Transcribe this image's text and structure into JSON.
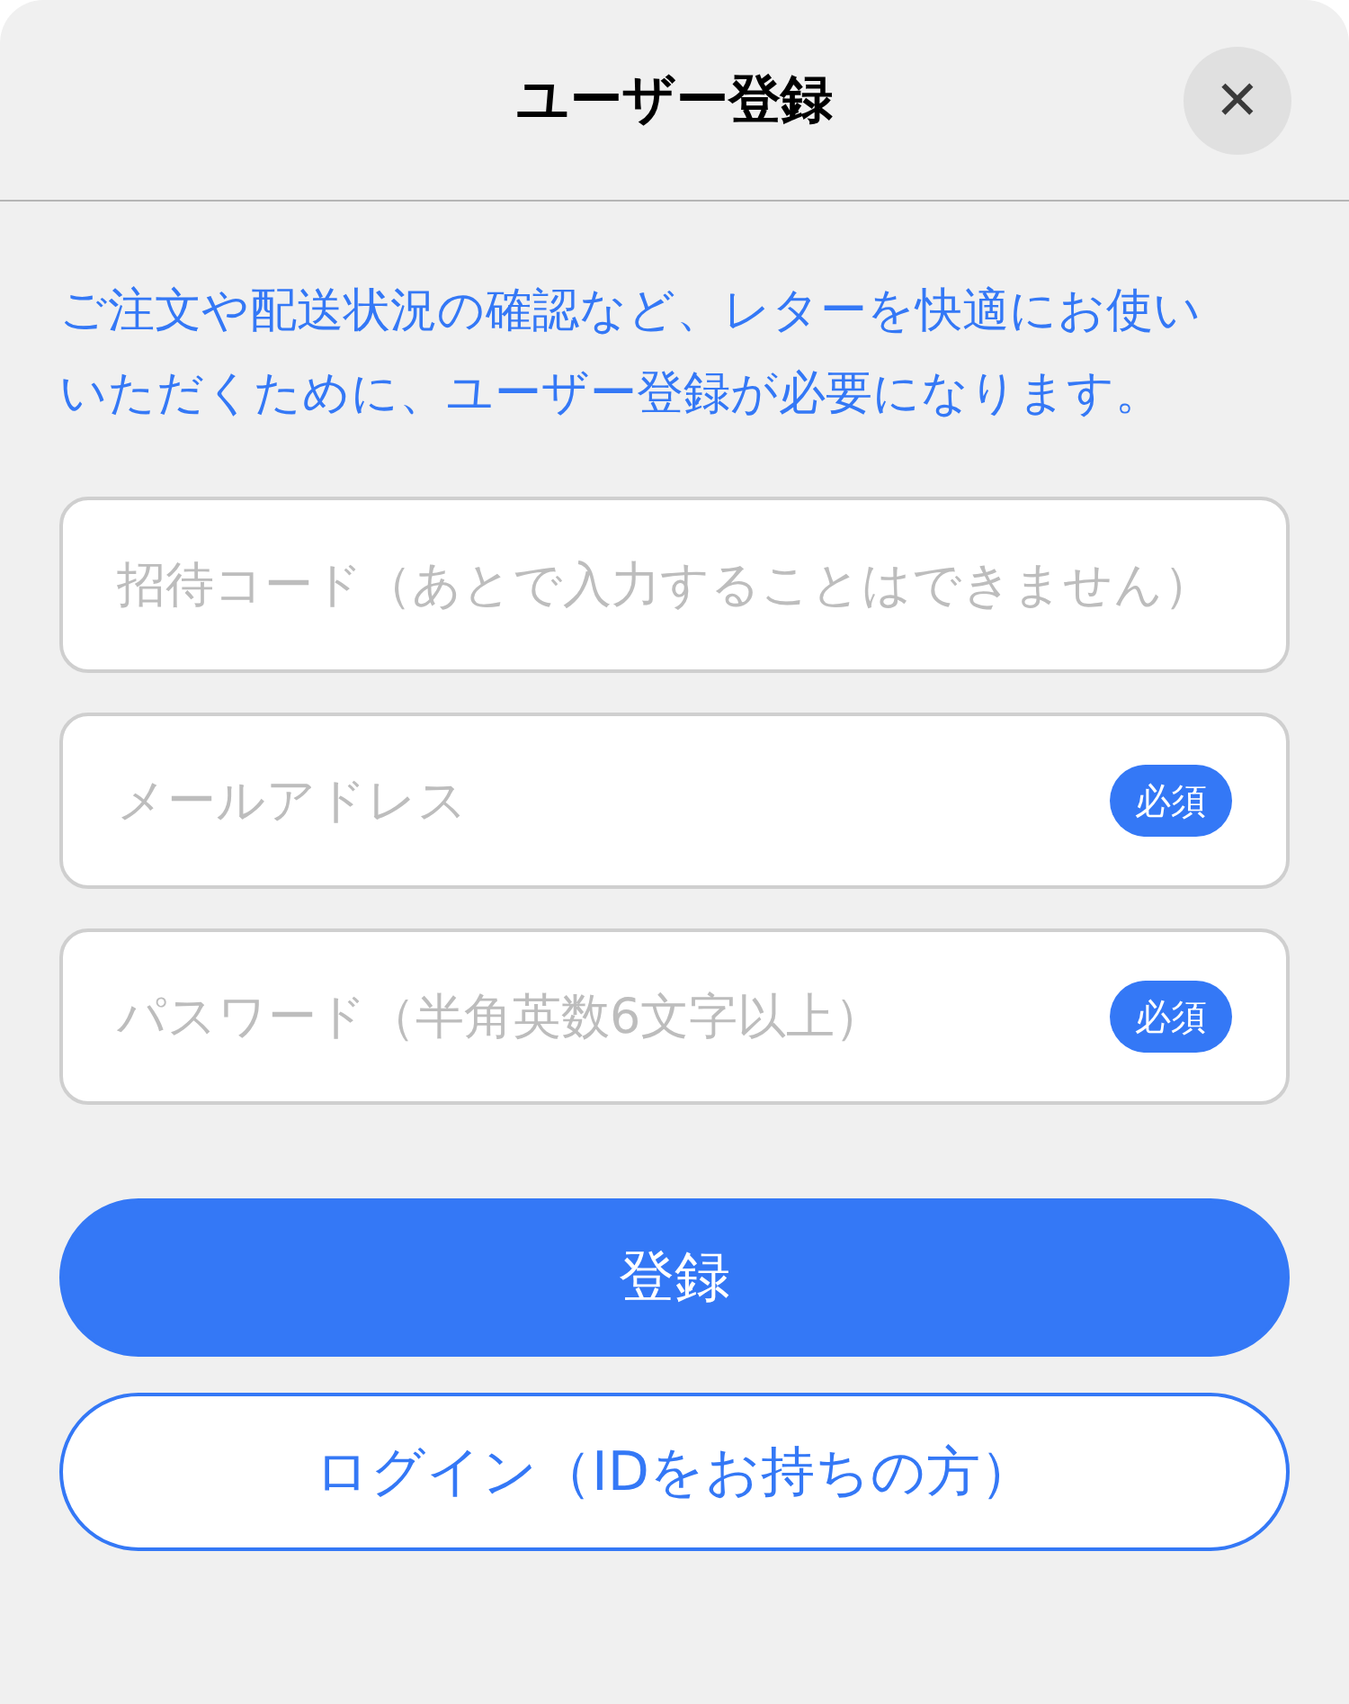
{
  "header": {
    "title": "ユーザー登録",
    "close": "✕"
  },
  "intro": "ご注文や配送状況の確認など、レターを快適にお使いいただくために、ユーザー登録が必要になります。",
  "fields": [
    {
      "placeholder": "招待コード（あとで入力することはできません）"
    },
    {
      "placeholder": "メールアドレス",
      "badge": "必須"
    },
    {
      "placeholder": "パスワード（半角英数6文字以上）",
      "badge": "必須"
    }
  ],
  "buttons": [
    {
      "kind": "primary",
      "label": "登録"
    },
    {
      "kind": "outline",
      "label": "ログイン（IDをお持ちの方）"
    }
  ]
}
